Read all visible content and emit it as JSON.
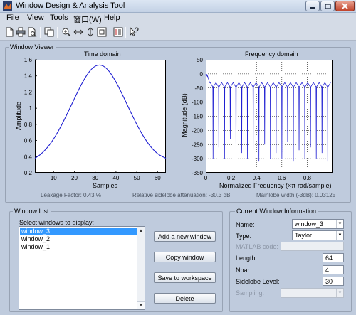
{
  "title_bar": {
    "title": "Window Design & Analysis Tool"
  },
  "menu": [
    "File",
    "View",
    "Tools",
    "窗口(W)",
    "Help"
  ],
  "toolbar_icons": [
    "new-icon",
    "print-icon",
    "print-preview-icon",
    "copy-figure-icon",
    "zoom-in-icon",
    "zoom-x-icon",
    "zoom-y-icon",
    "full-view-icon",
    "legend-icon",
    "whats-this-icon"
  ],
  "viewer": {
    "title": "Window Viewer",
    "time_domain": {
      "title": "Time domain",
      "xlabel": "Samples",
      "ylabel": "Amplitude"
    },
    "frequency_domain": {
      "title": "Frequency domain",
      "xlabel": "Normalized Frequency  (×π rad/sample)",
      "ylabel": "Magnitude (dB)"
    },
    "leakage": "Leakage Factor: 0.43 %",
    "sidelobe_attenuation": "Relative sidelobe attenuation: -30.3 dB",
    "mainlobe_width": "Mainlobe width (-3dB): 0.03125"
  },
  "chart_data": [
    {
      "type": "line",
      "title": "Time domain",
      "xlabel": "Samples",
      "ylabel": "Amplitude",
      "xlim": [
        1,
        64
      ],
      "ylim": [
        0.2,
        1.6
      ],
      "xticks": [
        10,
        20,
        30,
        40,
        50,
        60
      ],
      "yticks": [
        0.2,
        0.4,
        0.6,
        0.8,
        1.0,
        1.2,
        1.4,
        1.6
      ],
      "series": [
        {
          "color": "#1f1fd2",
          "x": [
            1,
            4,
            8,
            12,
            16,
            20,
            24,
            28,
            32,
            36,
            40,
            44,
            48,
            52,
            56,
            60,
            64
          ],
          "y": [
            0.38,
            0.43,
            0.54,
            0.7,
            0.9,
            1.12,
            1.33,
            1.49,
            1.55,
            1.49,
            1.33,
            1.12,
            0.9,
            0.7,
            0.54,
            0.43,
            0.38
          ]
        }
      ]
    },
    {
      "type": "line",
      "title": "Frequency domain",
      "xlabel": "Normalized Frequency  (×π rad/sample)",
      "ylabel": "Magnitude (dB)",
      "xlim": [
        0,
        1
      ],
      "ylim": [
        -350,
        50
      ],
      "xticks": [
        0,
        0.2,
        0.4,
        0.6,
        0.8
      ],
      "yticks": [
        50,
        0,
        -50,
        -100,
        -150,
        -200,
        -250,
        -300,
        -350
      ],
      "grid": true,
      "series": [
        {
          "color": "#1f1fd2",
          "description_free": true,
          "mainlobe": {
            "x": [
              0,
              0.01,
              0.02,
              0.03
            ],
            "y": [
              0,
              -3,
              -15,
              -31
            ]
          },
          "sidelobe_level": -31,
          "null_depths": [
            -300,
            -260,
            -300,
            -230,
            -310,
            -280,
            -300,
            -270,
            -310,
            -250,
            -300,
            -280,
            -300,
            -240,
            -310,
            -270,
            -300,
            -260,
            -300,
            -280,
            -310
          ]
        }
      ]
    }
  ],
  "window_list": {
    "title": "Window List",
    "select_label": "Select windows to display:",
    "items": [
      {
        "name": "window_3",
        "selected": true
      },
      {
        "name": "window_2",
        "selected": false
      },
      {
        "name": "window_1",
        "selected": false
      }
    ],
    "buttons": {
      "add": "Add a new window",
      "copy": "Copy window",
      "save": "Save to workspace",
      "delete": "Delete"
    }
  },
  "current_window": {
    "title": "Current Window Information",
    "name_label": "Name:",
    "name_value": "window_3",
    "type_label": "Type:",
    "type_value": "Taylor",
    "matlab_code_label": "MATLAB code:",
    "matlab_code_value": "",
    "length_label": "Length:",
    "length_value": "64",
    "nbar_label": "Nbar:",
    "nbar_value": "4",
    "sidelobe_label": "Sidelobe Level:",
    "sidelobe_value": "30",
    "sampling_label": "Sampling:",
    "sampling_value": ""
  }
}
